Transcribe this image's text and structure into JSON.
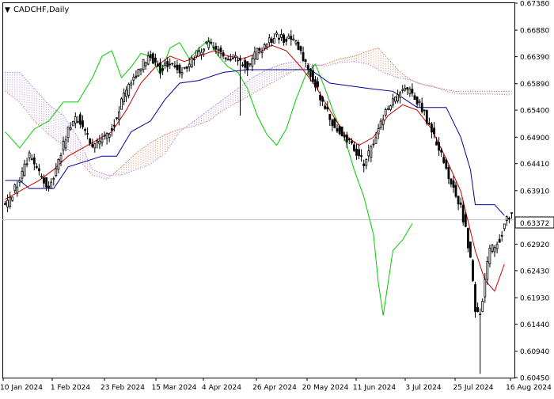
{
  "window": {
    "title": "CADCHF,Daily",
    "menu_icon": "triangle-down-icon"
  },
  "chart_data": {
    "type": "candlestick",
    "symbol": "CADCHF",
    "timeframe": "Daily",
    "current_price": "0.63372",
    "ylim": [
      0.6045,
      0.6738
    ],
    "y_ticks": [
      "0.67380",
      "0.66880",
      "0.66390",
      "0.65890",
      "0.65400",
      "0.64900",
      "0.64410",
      "0.63910",
      "0.63372",
      "0.62920",
      "0.62430",
      "0.61930",
      "0.61440",
      "0.60940",
      "0.60450"
    ],
    "x_ticks": [
      "10 Jan 2024",
      "1 Feb 2024",
      "23 Feb 2024",
      "15 Mar 2024",
      "4 Apr 2024",
      "26 Apr 2024",
      "20 May 2024",
      "11 Jun 2024",
      "3 Jul 2024",
      "25 Jul 2024",
      "16 Aug 2024"
    ],
    "price_path": [
      [
        0,
        0.6362
      ],
      [
        6,
        0.641
      ],
      [
        10,
        0.6455
      ],
      [
        14,
        0.642
      ],
      [
        18,
        0.6395
      ],
      [
        22,
        0.6445
      ],
      [
        26,
        0.6505
      ],
      [
        30,
        0.6525
      ],
      [
        36,
        0.6475
      ],
      [
        40,
        0.649
      ],
      [
        44,
        0.6505
      ],
      [
        48,
        0.6555
      ],
      [
        52,
        0.6592
      ],
      [
        56,
        0.6622
      ],
      [
        60,
        0.664
      ],
      [
        64,
        0.6615
      ],
      [
        68,
        0.6632
      ],
      [
        72,
        0.661
      ],
      [
        76,
        0.6625
      ],
      [
        80,
        0.665
      ],
      [
        84,
        0.6665
      ],
      [
        88,
        0.6648
      ],
      [
        92,
        0.6628
      ],
      [
        96,
        0.6635
      ],
      [
        100,
        0.662
      ],
      [
        104,
        0.6648
      ],
      [
        108,
        0.6665
      ],
      [
        112,
        0.6675
      ],
      [
        116,
        0.6672
      ],
      [
        120,
        0.6665
      ],
      [
        124,
        0.663
      ],
      [
        128,
        0.6585
      ],
      [
        132,
        0.6545
      ],
      [
        136,
        0.6508
      ],
      [
        140,
        0.6495
      ],
      [
        144,
        0.647
      ],
      [
        148,
        0.644
      ],
      [
        152,
        0.648
      ],
      [
        156,
        0.6528
      ],
      [
        160,
        0.656
      ],
      [
        164,
        0.658
      ],
      [
        168,
        0.657
      ],
      [
        172,
        0.6545
      ],
      [
        176,
        0.65
      ],
      [
        180,
        0.6455
      ],
      [
        184,
        0.6405
      ],
      [
        188,
        0.636
      ],
      [
        190,
        0.632
      ],
      [
        192,
        0.626
      ],
      [
        194,
        0.6175
      ],
      [
        196,
        0.616
      ],
      [
        198,
        0.6225
      ],
      [
        200,
        0.628
      ],
      [
        204,
        0.63
      ],
      [
        206,
        0.633
      ],
      [
        208,
        0.6345
      ]
    ],
    "indicators": {
      "tenkan_sen": {
        "color": "#cc0000",
        "points": [
          [
            0,
            0.6375
          ],
          [
            8,
            0.6395
          ],
          [
            14,
            0.641
          ],
          [
            20,
            0.643
          ],
          [
            26,
            0.6455
          ],
          [
            32,
            0.647
          ],
          [
            38,
            0.6485
          ],
          [
            44,
            0.65
          ],
          [
            50,
            0.654
          ],
          [
            56,
            0.659
          ],
          [
            62,
            0.662
          ],
          [
            68,
            0.664
          ],
          [
            74,
            0.663
          ],
          [
            80,
            0.664
          ],
          [
            86,
            0.665
          ],
          [
            92,
            0.664
          ],
          [
            98,
            0.6635
          ],
          [
            104,
            0.6645
          ],
          [
            110,
            0.666
          ],
          [
            116,
            0.665
          ],
          [
            122,
            0.662
          ],
          [
            128,
            0.6585
          ],
          [
            134,
            0.654
          ],
          [
            140,
            0.6495
          ],
          [
            146,
            0.6475
          ],
          [
            152,
            0.649
          ],
          [
            158,
            0.653
          ],
          [
            164,
            0.655
          ],
          [
            170,
            0.654
          ],
          [
            176,
            0.6505
          ],
          [
            182,
            0.645
          ],
          [
            188,
            0.639
          ],
          [
            194,
            0.628
          ],
          [
            198,
            0.6225
          ],
          [
            202,
            0.6205
          ],
          [
            206,
            0.6255
          ]
        ]
      },
      "kijun_sen": {
        "color": "#000099",
        "points": [
          [
            0,
            0.641
          ],
          [
            6,
            0.641
          ],
          [
            10,
            0.6395
          ],
          [
            20,
            0.6395
          ],
          [
            26,
            0.6435
          ],
          [
            40,
            0.6455
          ],
          [
            46,
            0.6455
          ],
          [
            52,
            0.65
          ],
          [
            60,
            0.652
          ],
          [
            66,
            0.656
          ],
          [
            72,
            0.659
          ],
          [
            80,
            0.6595
          ],
          [
            90,
            0.661
          ],
          [
            100,
            0.6615
          ],
          [
            110,
            0.6615
          ],
          [
            118,
            0.6615
          ],
          [
            126,
            0.6615
          ],
          [
            134,
            0.659
          ],
          [
            150,
            0.658
          ],
          [
            160,
            0.6575
          ],
          [
            170,
            0.6545
          ],
          [
            182,
            0.6545
          ],
          [
            188,
            0.649
          ],
          [
            192,
            0.643
          ],
          [
            194,
            0.6365
          ],
          [
            202,
            0.6365
          ],
          [
            206,
            0.6345
          ]
        ]
      },
      "chikou_span": {
        "color": "#00cc00",
        "points": [
          [
            0,
            0.65
          ],
          [
            6,
            0.647
          ],
          [
            12,
            0.6505
          ],
          [
            18,
            0.652
          ],
          [
            24,
            0.6555
          ],
          [
            30,
            0.6555
          ],
          [
            36,
            0.66
          ],
          [
            40,
            0.664
          ],
          [
            44,
            0.665
          ],
          [
            48,
            0.66
          ],
          [
            52,
            0.662
          ],
          [
            56,
            0.6645
          ],
          [
            60,
            0.664
          ],
          [
            64,
            0.6605
          ],
          [
            68,
            0.6655
          ],
          [
            72,
            0.6665
          ],
          [
            76,
            0.6635
          ],
          [
            80,
            0.6655
          ],
          [
            84,
            0.667
          ],
          [
            88,
            0.664
          ],
          [
            92,
            0.662
          ],
          [
            96,
            0.661
          ],
          [
            100,
            0.658
          ],
          [
            104,
            0.653
          ],
          [
            108,
            0.6495
          ],
          [
            112,
            0.6475
          ],
          [
            116,
            0.6505
          ],
          [
            120,
            0.656
          ],
          [
            124,
            0.6605
          ],
          [
            128,
            0.6625
          ],
          [
            132,
            0.658
          ],
          [
            136,
            0.653
          ],
          [
            140,
            0.649
          ],
          [
            144,
            0.643
          ],
          [
            148,
            0.638
          ],
          [
            152,
            0.631
          ],
          [
            154,
            0.622
          ],
          [
            156,
            0.616
          ],
          [
            160,
            0.628
          ],
          [
            164,
            0.63
          ],
          [
            168,
            0.633
          ]
        ]
      },
      "senkou_span_a": {
        "color": "#cc6633",
        "points": [
          [
            0,
            0.6575
          ],
          [
            6,
            0.6555
          ],
          [
            12,
            0.652
          ],
          [
            18,
            0.6495
          ],
          [
            24,
            0.6475
          ],
          [
            30,
            0.645
          ],
          [
            36,
            0.642
          ],
          [
            42,
            0.6412
          ],
          [
            48,
            0.6435
          ],
          [
            54,
            0.646
          ],
          [
            60,
            0.648
          ],
          [
            66,
            0.6495
          ],
          [
            72,
            0.6505
          ],
          [
            78,
            0.651
          ],
          [
            84,
            0.652
          ],
          [
            90,
            0.654
          ],
          [
            96,
            0.6555
          ],
          [
            102,
            0.657
          ],
          [
            108,
            0.6585
          ],
          [
            114,
            0.66
          ],
          [
            120,
            0.6615
          ],
          [
            126,
            0.662
          ],
          [
            132,
            0.6625
          ],
          [
            138,
            0.6635
          ],
          [
            144,
            0.664
          ],
          [
            150,
            0.665
          ],
          [
            154,
            0.6655
          ],
          [
            158,
            0.6635
          ],
          [
            162,
            0.6615
          ],
          [
            166,
            0.66
          ],
          [
            170,
            0.659
          ],
          [
            176,
            0.6585
          ],
          [
            182,
            0.6575
          ],
          [
            188,
            0.657
          ],
          [
            194,
            0.657
          ],
          [
            200,
            0.657
          ],
          [
            208,
            0.6568
          ]
        ]
      },
      "senkou_span_b": {
        "color": "#9966cc",
        "points": [
          [
            0,
            0.661
          ],
          [
            6,
            0.661
          ],
          [
            12,
            0.658
          ],
          [
            18,
            0.655
          ],
          [
            24,
            0.653
          ],
          [
            30,
            0.649
          ],
          [
            36,
            0.643
          ],
          [
            42,
            0.642
          ],
          [
            48,
            0.642
          ],
          [
            54,
            0.643
          ],
          [
            60,
            0.644
          ],
          [
            66,
            0.646
          ],
          [
            72,
            0.65
          ],
          [
            78,
            0.652
          ],
          [
            84,
            0.654
          ],
          [
            90,
            0.656
          ],
          [
            96,
            0.658
          ],
          [
            102,
            0.66
          ],
          [
            108,
            0.6615
          ],
          [
            114,
            0.6625
          ],
          [
            120,
            0.663
          ],
          [
            126,
            0.6625
          ],
          [
            132,
            0.6622
          ],
          [
            138,
            0.6628
          ],
          [
            144,
            0.663
          ],
          [
            150,
            0.6625
          ],
          [
            156,
            0.661
          ],
          [
            162,
            0.66
          ],
          [
            168,
            0.6595
          ],
          [
            174,
            0.6585
          ],
          [
            180,
            0.658
          ],
          [
            186,
            0.6575
          ],
          [
            192,
            0.6575
          ],
          [
            200,
            0.6575
          ],
          [
            208,
            0.6575
          ]
        ]
      }
    }
  }
}
